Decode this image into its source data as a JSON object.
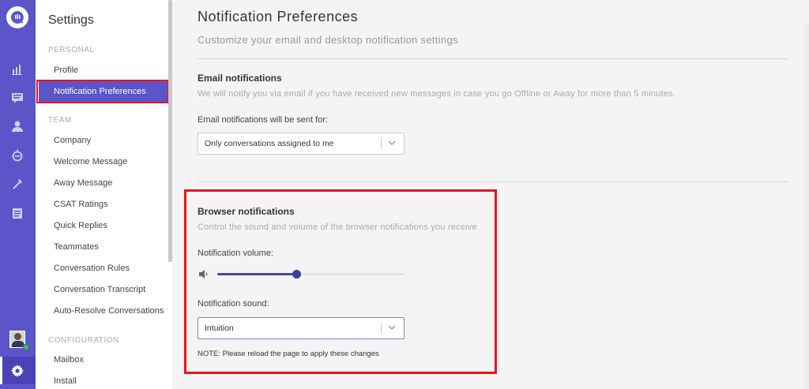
{
  "rail": {
    "icons": [
      "chat-logo-icon",
      "reports-icon",
      "conversations-icon",
      "contacts-icon",
      "bot-icon",
      "integrations-icon",
      "knowledge-base-icon",
      "settings-gear-icon"
    ],
    "status": "online",
    "accent": "#5c54c9"
  },
  "sidebar": {
    "title": "Settings",
    "sections": [
      {
        "header": "PERSONAL",
        "items": [
          "Profile",
          "Notification Preferences"
        ]
      },
      {
        "header": "TEAM",
        "items": [
          "Company",
          "Welcome Message",
          "Away Message",
          "CSAT Ratings",
          "Quick Replies",
          "Teammates",
          "Conversation Rules",
          "Conversation Transcript",
          "Auto-Resolve Conversations"
        ]
      },
      {
        "header": "CONFIGURATION",
        "items": [
          "Mailbox",
          "Install"
        ]
      }
    ],
    "active_item": "Notification Preferences"
  },
  "main": {
    "title": "Notification Preferences",
    "subtitle": "Customize your email and desktop notification settings",
    "email": {
      "heading": "Email notifications",
      "description": "We will notify you via email if you have received new messages in case you go Offline or Away for more than 5 minutes.",
      "select_label": "Email notifications will be sent for:",
      "select_value": "Only conversations assigned to me"
    },
    "browser": {
      "heading": "Browser notifications",
      "description": "Control the sound and volume of the browser notifications you receive",
      "volume_label": "Notification volume:",
      "volume_level": 0.42,
      "sound_label": "Notification sound:",
      "sound_value": "Intuition",
      "note": "NOTE: Please reload the page to apply these changes"
    }
  }
}
